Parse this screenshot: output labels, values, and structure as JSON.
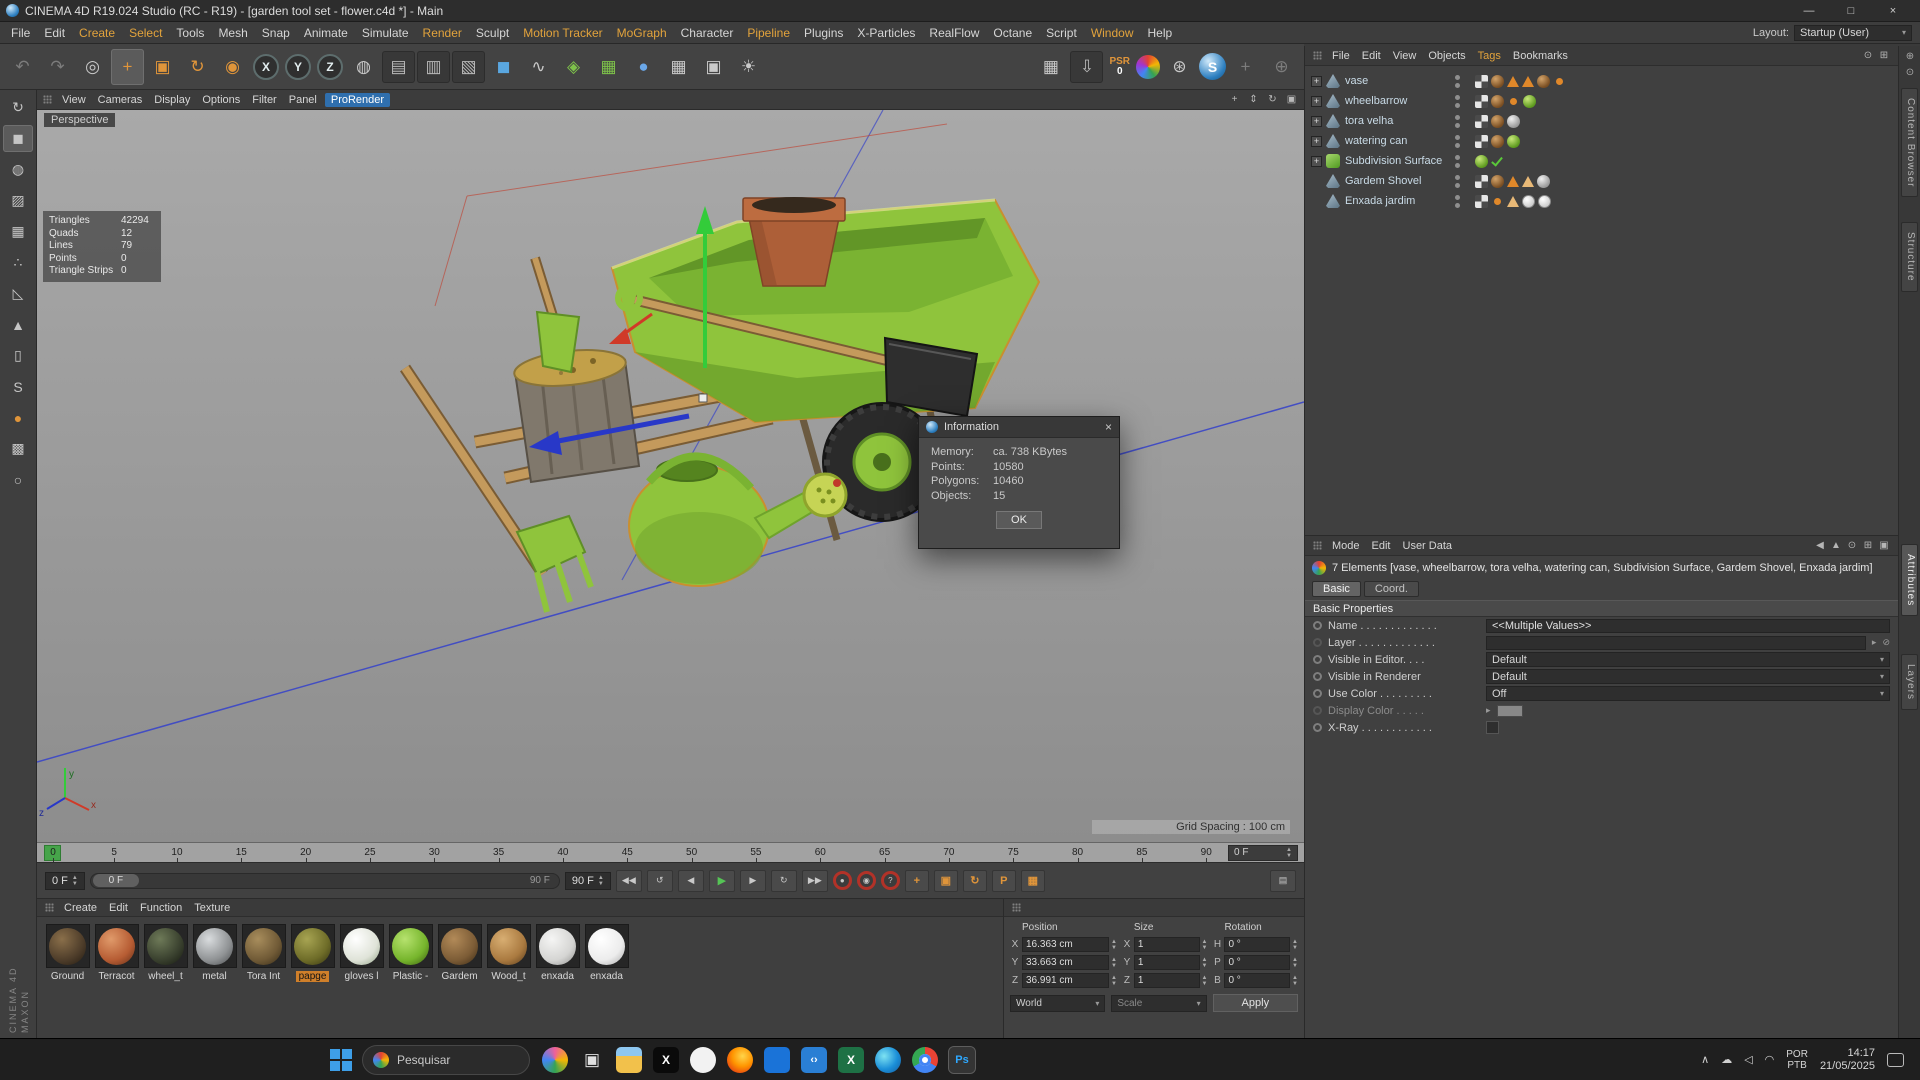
{
  "window": {
    "title": "CINEMA 4D R19.024 Studio (RC - R19) - [garden tool set - flower.c4d *] - Main",
    "minimize": "—",
    "maximize": "□",
    "close": "×"
  },
  "menu_bar": {
    "items": [
      {
        "label": "File",
        "cls": ""
      },
      {
        "label": "Edit",
        "cls": ""
      },
      {
        "label": "Create",
        "cls": "accent"
      },
      {
        "label": "Select",
        "cls": "accent"
      },
      {
        "label": "Tools",
        "cls": ""
      },
      {
        "label": "Mesh",
        "cls": ""
      },
      {
        "label": "Snap",
        "cls": ""
      },
      {
        "label": "Animate",
        "cls": ""
      },
      {
        "label": "Simulate",
        "cls": ""
      },
      {
        "label": "Render",
        "cls": "accent"
      },
      {
        "label": "Sculpt",
        "cls": ""
      },
      {
        "label": "Motion Tracker",
        "cls": "accent"
      },
      {
        "label": "MoGraph",
        "cls": "accent"
      },
      {
        "label": "Character",
        "cls": ""
      },
      {
        "label": "Pipeline",
        "cls": "accent"
      },
      {
        "label": "Plugins",
        "cls": ""
      },
      {
        "label": "X-Particles",
        "cls": ""
      },
      {
        "label": "RealFlow",
        "cls": ""
      },
      {
        "label": "Octane",
        "cls": ""
      },
      {
        "label": "Script",
        "cls": ""
      },
      {
        "label": "Window",
        "cls": "accent"
      },
      {
        "label": "Help",
        "cls": ""
      }
    ],
    "layout_label": "Layout:",
    "layout_value": "Startup (User)"
  },
  "toolbar": {
    "main": [
      {
        "name": "undo-icon",
        "glyph": "↶",
        "cls": "dim"
      },
      {
        "name": "redo-icon",
        "glyph": "↷",
        "cls": "dim"
      },
      {
        "name": "live-selection-icon",
        "glyph": "◎",
        "cls": ""
      },
      {
        "name": "move-tool-icon",
        "glyph": "+",
        "cls": "orange active"
      },
      {
        "name": "scale-tool-icon",
        "glyph": "▣",
        "cls": "orange"
      },
      {
        "name": "rotate-tool-icon",
        "glyph": "↻",
        "cls": "orange"
      },
      {
        "name": "last-used-tool-icon",
        "glyph": "◉",
        "cls": "orange"
      },
      {
        "name": "lock-x-axis-button",
        "glyph": "X",
        "cls": "axis"
      },
      {
        "name": "lock-y-axis-button",
        "glyph": "Y",
        "cls": "axis"
      },
      {
        "name": "lock-z-axis-button",
        "glyph": "Z",
        "cls": "axis"
      },
      {
        "name": "coordinate-system-button",
        "glyph": "◍",
        "cls": ""
      },
      {
        "name": "render-view-button",
        "glyph": "▤",
        "cls": "dark"
      },
      {
        "name": "render-picture-viewer-button",
        "glyph": "▥",
        "cls": "dark"
      },
      {
        "name": "render-settings-button",
        "glyph": "▧",
        "cls": "dark"
      },
      {
        "name": "add-cube-button",
        "glyph": "◼",
        "cls": "blue"
      },
      {
        "name": "pen-tool-button",
        "glyph": "∿",
        "cls": ""
      },
      {
        "name": "mograph-button",
        "glyph": "◈",
        "cls": "greenish"
      },
      {
        "name": "field-button",
        "glyph": "▦",
        "cls": "greenish"
      },
      {
        "name": "simulate-button",
        "glyph": "●",
        "cls": "blueish"
      },
      {
        "name": "floor-button",
        "glyph": "▦",
        "cls": ""
      },
      {
        "name": "camera-button",
        "glyph": "▣",
        "cls": ""
      },
      {
        "name": "light-button",
        "glyph": "☀",
        "cls": ""
      }
    ],
    "right": [
      {
        "name": "workplane-button",
        "glyph": "▦",
        "cls": ""
      },
      {
        "name": "content-download-button",
        "glyph": "⇩",
        "cls": "dark"
      }
    ],
    "psr_label": "PSR",
    "psr_badge": "0",
    "right2": [
      {
        "name": "material-sphere-icon",
        "glyph": "",
        "cls": "ball"
      },
      {
        "name": "settings-gear-icon",
        "glyph": "⊛",
        "cls": ""
      },
      {
        "name": "c4d-logo-icon",
        "glyph": "S",
        "cls": "logo"
      },
      {
        "name": "dock-move-icon",
        "glyph": "+",
        "cls": "dim"
      },
      {
        "name": "dock-target-icon",
        "glyph": "⊕",
        "cls": "dim"
      }
    ]
  },
  "left_toolbar": {
    "items": [
      {
        "name": "convert-icon",
        "glyph": "↻",
        "cls": ""
      },
      {
        "name": "model-mode-icon",
        "glyph": "◼",
        "cls": "active"
      },
      {
        "name": "texture-mode-icon",
        "glyph": "◍",
        "cls": ""
      },
      {
        "name": "texture-axis-icon",
        "glyph": "▨",
        "cls": ""
      },
      {
        "name": "workplane-mode-icon",
        "glyph": "▦",
        "cls": ""
      },
      {
        "name": "points-mode-icon",
        "glyph": "∴",
        "cls": ""
      },
      {
        "name": "edges-mode-icon",
        "glyph": "◺",
        "cls": ""
      },
      {
        "name": "polygons-mode-icon",
        "glyph": "▲",
        "cls": ""
      },
      {
        "name": "tweak-mode-icon",
        "glyph": "▯",
        "cls": ""
      },
      {
        "name": "snap-icon",
        "glyph": "S",
        "cls": ""
      },
      {
        "name": "paint-icon",
        "glyph": "●",
        "cls": "orange"
      },
      {
        "name": "lock-workplane-icon",
        "glyph": "▩",
        "cls": ""
      },
      {
        "name": "symmetry-icon",
        "glyph": "○",
        "cls": ""
      }
    ]
  },
  "viewport": {
    "label": "Perspective",
    "menu": [
      {
        "label": "View",
        "cls": ""
      },
      {
        "label": "Cameras",
        "cls": ""
      },
      {
        "label": "Display",
        "cls": ""
      },
      {
        "label": "Options",
        "cls": ""
      },
      {
        "label": "Filter",
        "cls": ""
      },
      {
        "label": "Panel",
        "cls": ""
      },
      {
        "label": "ProRender",
        "cls": "prorender"
      }
    ],
    "view_icons": [
      {
        "name": "pan-view-icon",
        "glyph": "+"
      },
      {
        "name": "zoom-view-icon",
        "glyph": "⇕"
      },
      {
        "name": "rotate-view-icon",
        "glyph": "↻"
      },
      {
        "name": "toggle-view-icon",
        "glyph": "▣"
      }
    ],
    "stats": [
      {
        "label": "Triangles",
        "value": "42294"
      },
      {
        "label": "Quads",
        "value": "12"
      },
      {
        "label": "Lines",
        "value": "79"
      },
      {
        "label": "Points",
        "value": "0"
      },
      {
        "label": "Triangle Strips",
        "value": "0"
      }
    ],
    "grid_spacing": "Grid Spacing : 100 cm",
    "axis": {
      "x": "x",
      "y": "y",
      "z": "z"
    }
  },
  "info_dialog": {
    "title": "Information",
    "close": "×",
    "rows": [
      {
        "label": "Memory:",
        "value": "ca. 738 KBytes"
      },
      {
        "label": "Points:",
        "value": "10580"
      },
      {
        "label": "Polygons:",
        "value": "10460"
      },
      {
        "label": "Objects:",
        "value": "15"
      }
    ],
    "ok_label": "OK"
  },
  "object_manager": {
    "menu": [
      {
        "label": "File",
        "cls": ""
      },
      {
        "label": "Edit",
        "cls": ""
      },
      {
        "label": "View",
        "cls": ""
      },
      {
        "label": "Objects",
        "cls": ""
      },
      {
        "label": "Tags",
        "cls": "accent"
      },
      {
        "label": "Bookmarks",
        "cls": ""
      }
    ],
    "right_icons": [
      {
        "name": "search-icon",
        "glyph": "⊙"
      },
      {
        "name": "filter-icon",
        "glyph": "⊞"
      }
    ],
    "objects": [
      {
        "exp": "+",
        "expcls": "on",
        "icon": "icon-poly",
        "name": "vase",
        "tags": [
          "checker",
          "matbrown",
          "tri",
          "tri",
          "matbrown",
          "dot"
        ]
      },
      {
        "exp": "+",
        "expcls": "on",
        "icon": "icon-poly",
        "name": "wheelbarrow",
        "tags": [
          "checker",
          "matbrown",
          "dot",
          "matgreen"
        ]
      },
      {
        "exp": "+",
        "expcls": "on",
        "icon": "icon-poly",
        "name": "tora velha",
        "tags": [
          "checker",
          "matbrown",
          "matgray"
        ]
      },
      {
        "exp": "+",
        "expcls": "on",
        "icon": "icon-poly",
        "name": "watering can",
        "tags": [
          "checker",
          "matbrown",
          "matgreen"
        ]
      },
      {
        "exp": "+",
        "expcls": "on",
        "icon": "icon-subd",
        "name": "Subdivision Surface",
        "tags": [
          "matgreen",
          "check"
        ]
      },
      {
        "exp": "",
        "expcls": "off",
        "icon": "icon-poly",
        "name": "Gardem Shovel",
        "tags": [
          "checker",
          "matbrown",
          "tri",
          "trio",
          "matgray"
        ]
      },
      {
        "exp": "",
        "expcls": "off",
        "icon": "icon-poly",
        "name": "Enxada jardim",
        "tags": [
          "checker",
          "dot",
          "trio",
          "matwhite",
          "matwhite"
        ]
      }
    ]
  },
  "attributes": {
    "menu": [
      "Mode",
      "Edit",
      "User Data"
    ],
    "right_icons": [
      {
        "name": "history-back-icon",
        "glyph": "◀"
      },
      {
        "name": "history-up-icon",
        "glyph": "▲"
      },
      {
        "name": "search-icon",
        "glyph": "⊙"
      },
      {
        "name": "dock-icon",
        "glyph": "⊞"
      },
      {
        "name": "lock-icon",
        "glyph": "▣"
      }
    ],
    "summary": "7 Elements [vase, wheelbarrow, tora velha, watering can, Subdivision Surface, Gardem Shovel, Enxada jardim]",
    "tab_basic": "Basic",
    "tab_coord": "Coord.",
    "section": "Basic Properties",
    "rows": [
      {
        "label": "Name . . . . . . . . . . . . .",
        "value": "<<Multiple Values>>"
      },
      {
        "label": "Layer . . . . . . . . . . . . .",
        "value": ""
      },
      {
        "label": "Visible in Editor. . . .",
        "value": "Default"
      },
      {
        "label": "Visible in Renderer",
        "value": "Default"
      },
      {
        "label": "Use Color . . . . . . . . .",
        "value": "Off"
      },
      {
        "label": "Display Color . . . . .",
        "value": ""
      },
      {
        "label": "X-Ray . . . . . . . . . . . .",
        "value": ""
      }
    ]
  },
  "right_strip": {
    "icons": [
      {
        "name": "pin-icon",
        "glyph": "⊕"
      },
      {
        "name": "search-icon",
        "glyph": "⊙"
      }
    ],
    "tabs": [
      {
        "label": "Content Browser",
        "cls": ""
      },
      {
        "label": "Structure",
        "cls": ""
      },
      {
        "label": "Attributes",
        "cls": "on"
      },
      {
        "label": "Layers",
        "cls": ""
      }
    ]
  },
  "timeline": {
    "ticks": [
      "0",
      "5",
      "10",
      "15",
      "20",
      "25",
      "30",
      "35",
      "40",
      "45",
      "50",
      "55",
      "60",
      "65",
      "70",
      "75",
      "80",
      "85",
      "90"
    ],
    "ruler_field": "0 F",
    "start_field": "0 F",
    "slider_left": "0 F",
    "slider_right": "90 F",
    "end_field": "90 F",
    "transport": [
      {
        "name": "goto-start-button",
        "glyph": "◀◀",
        "cls": ""
      },
      {
        "name": "prev-key-button",
        "glyph": "↺",
        "cls": ""
      },
      {
        "name": "prev-frame-button",
        "glyph": "◀",
        "cls": ""
      },
      {
        "name": "play-button",
        "glyph": "▶",
        "cls": "green"
      },
      {
        "name": "next-frame-button",
        "glyph": "▶",
        "cls": ""
      },
      {
        "name": "loop-button",
        "glyph": "↻",
        "cls": ""
      },
      {
        "name": "goto-end-button",
        "glyph": "▶▶",
        "cls": ""
      }
    ],
    "record": [
      {
        "name": "record-keyframe-button",
        "glyph": "●"
      },
      {
        "name": "autokeying-button",
        "glyph": "◉"
      },
      {
        "name": "keyframe-selection-button",
        "glyph": "?"
      }
    ],
    "record2": [
      {
        "name": "record-position-button",
        "glyph": "+"
      },
      {
        "name": "record-scale-button",
        "glyph": "▣"
      },
      {
        "name": "record-rotation-button",
        "glyph": "↻"
      },
      {
        "name": "record-parameter-button",
        "glyph": "P"
      },
      {
        "name": "record-pla-button",
        "glyph": "▦"
      }
    ],
    "options_glyph": "▤"
  },
  "materials": {
    "menu": [
      "Create",
      "Edit",
      "Function",
      "Texture"
    ],
    "items": [
      {
        "name": "Ground",
        "cls": "m-ground",
        "sel": "",
        "color": "#4e3d2a"
      },
      {
        "name": "Terracot",
        "cls": "m-terra",
        "sel": "",
        "color": "#b65c33"
      },
      {
        "name": "wheel_t",
        "cls": "m-wheel",
        "sel": "",
        "color": "#39402e"
      },
      {
        "name": "metal",
        "cls": "m-metal",
        "sel": "",
        "color": "#8f9294"
      },
      {
        "name": "Tora Int",
        "cls": "m-tora",
        "sel": "",
        "color": "#705a36"
      },
      {
        "name": "papge",
        "cls": "m-papge",
        "sel": "selected",
        "color": "#6e6c28"
      },
      {
        "name": "gloves l",
        "cls": "m-gloves",
        "sel": "",
        "color": "#dfe3d8"
      },
      {
        "name": "Plastic -",
        "cls": "m-plastic",
        "sel": "",
        "color": "#76b52c"
      },
      {
        "name": "Gardem",
        "cls": "m-gardem",
        "sel": "",
        "color": "#7c5c36"
      },
      {
        "name": "Wood_t",
        "cls": "m-wood",
        "sel": "",
        "color": "#aa7a40"
      },
      {
        "name": "enxada",
        "cls": "m-enx1",
        "sel": "",
        "color": "#d5d5d3"
      },
      {
        "name": "enxada",
        "cls": "m-enx2",
        "sel": "",
        "color": "#ececec"
      }
    ]
  },
  "coordinates": {
    "headers": [
      "Position",
      "Size",
      "Rotation"
    ],
    "rows": [
      {
        "pl": "X",
        "pv": "16.363 cm",
        "sl": "X",
        "sv": "1",
        "rl": "H",
        "rv": "0 °"
      },
      {
        "pl": "Y",
        "pv": "33.663 cm",
        "sl": "Y",
        "sv": "1",
        "rl": "P",
        "rv": "0 °"
      },
      {
        "pl": "Z",
        "pv": "36.991 cm",
        "sl": "Z",
        "sv": "1",
        "rl": "B",
        "rv": "0 °"
      }
    ],
    "world": "World",
    "scale": "Scale",
    "apply": "Apply"
  },
  "watermark": {
    "line1": "MAXON",
    "line2": "CINEMA 4D"
  },
  "taskbar": {
    "search_text": "Pesquisar",
    "apps": [
      {
        "name": "copilot-icon",
        "cls": "ic-copilot",
        "glyph": ""
      },
      {
        "name": "task-view-icon",
        "cls": "ic-taskview",
        "glyph": "▣"
      },
      {
        "name": "file-explorer-icon",
        "cls": "ic-explorer",
        "glyph": ""
      },
      {
        "name": "x-app-icon",
        "cls": "ic-x",
        "glyph": "X"
      },
      {
        "name": "chatgpt-icon",
        "cls": "ic-chatgpt",
        "glyph": ""
      },
      {
        "name": "firefox-icon",
        "cls": "ic-firefox",
        "glyph": ""
      },
      {
        "name": "outlook-icon",
        "cls": "ic-outlook",
        "glyph": ""
      },
      {
        "name": "vscode-icon",
        "cls": "ic-vscode",
        "glyph": "‹›"
      },
      {
        "name": "excel-icon",
        "cls": "ic-excel",
        "glyph": "X"
      },
      {
        "name": "edge-icon",
        "cls": "ic-edge",
        "glyph": ""
      },
      {
        "name": "chrome-icon",
        "cls": "ic-chrome",
        "glyph": ""
      },
      {
        "name": "photoshop-icon",
        "cls": "ic-photoshop active",
        "glyph": "Ps"
      }
    ],
    "tray_icons": [
      {
        "name": "hidden-icons-button",
        "glyph": "∧"
      },
      {
        "name": "onedrive-icon",
        "glyph": "☁"
      },
      {
        "name": "volume-icon",
        "glyph": "◁"
      },
      {
        "name": "network-icon",
        "glyph": "◠"
      }
    ],
    "lang1": "POR",
    "lang2": "PTB",
    "time": "14:17",
    "date": "21/05/2025"
  }
}
